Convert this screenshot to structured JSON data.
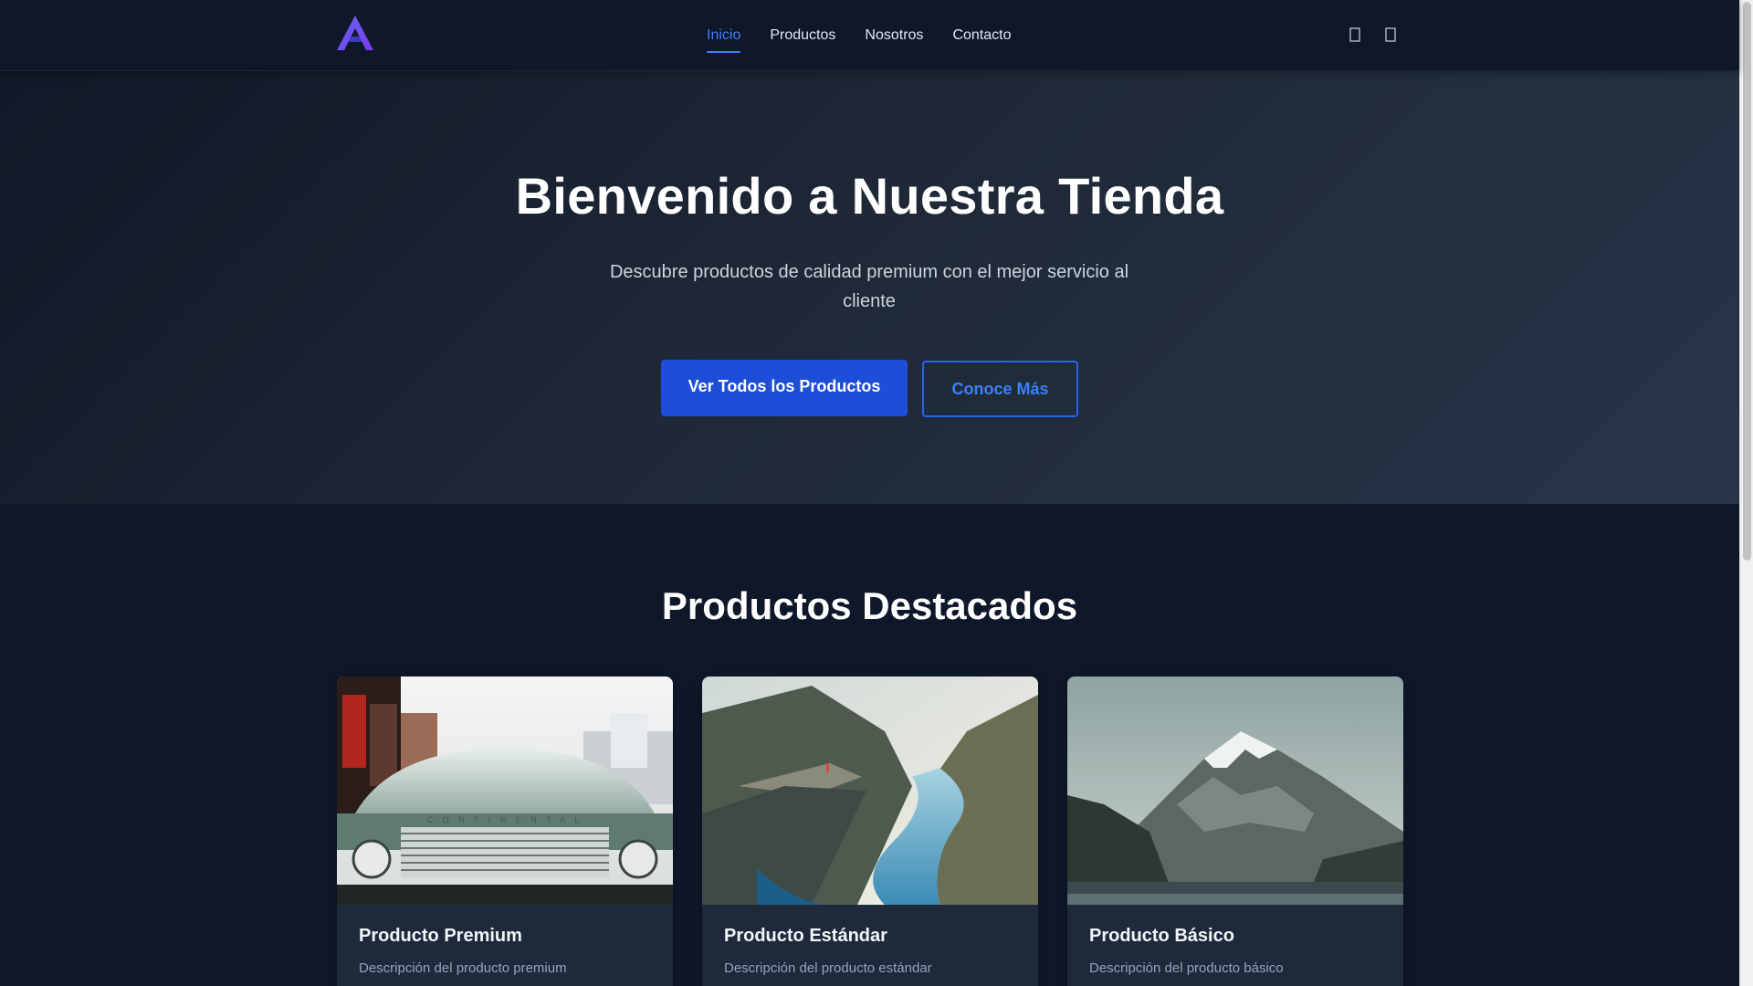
{
  "header": {
    "logo_icon": "stylized-A-logo",
    "nav": [
      {
        "label": "Inicio",
        "active": true
      },
      {
        "label": "Productos",
        "active": false
      },
      {
        "label": "Nosotros",
        "active": false
      },
      {
        "label": "Contacto",
        "active": false
      }
    ],
    "icons": [
      "search-icon",
      "cart-icon"
    ]
  },
  "hero": {
    "title": "Bienvenido a Nuestra Tienda",
    "subtitle": "Descubre productos de calidad premium con el mejor servicio al cliente",
    "primary_button": "Ver Todos los Productos",
    "secondary_button": "Conoce Más"
  },
  "featured": {
    "title": "Productos Destacados",
    "products": [
      {
        "name": "Producto Premium",
        "description": "Descripción del producto premium",
        "image": "vintage car photo"
      },
      {
        "name": "Producto Estándar",
        "description": "Descripción del producto estándar",
        "image": "fjord cliff photo"
      },
      {
        "name": "Producto Básico",
        "description": "Descripción del producto básico",
        "image": "snowy mountain photo"
      }
    ]
  },
  "colors": {
    "background": "#0f172a",
    "accent": "#3b82f6",
    "primary_button": "#1d4ed8",
    "card": "#1e293b",
    "logo_gradient": [
      "#4f46e5",
      "#7c3aed"
    ]
  }
}
